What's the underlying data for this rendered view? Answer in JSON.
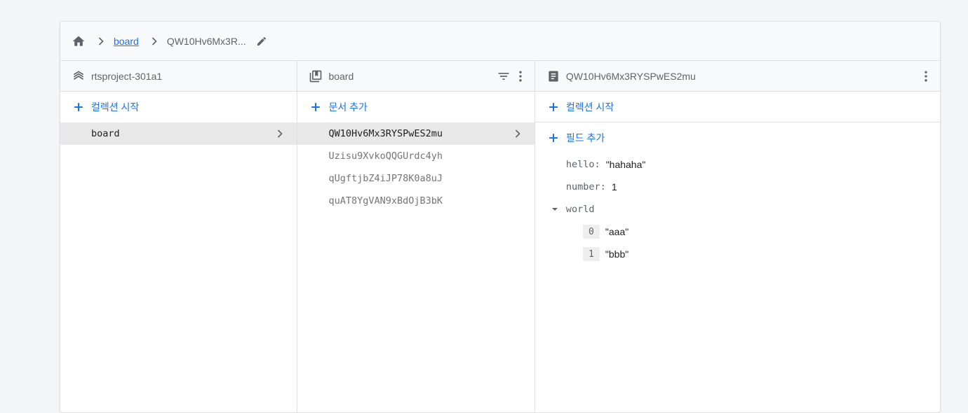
{
  "breadcrumb": {
    "collection": "board",
    "document": "QW10Hv6Mx3R..."
  },
  "columns": {
    "root": {
      "title": "rtsproject-301a1",
      "add_label": "컬렉션 시작",
      "items": [
        "board"
      ]
    },
    "collection": {
      "title": "board",
      "add_label": "문서 추가",
      "items": [
        "QW10Hv6Mx3RYSPwES2mu",
        "Uzisu9XvkoQQGUrdc4yh",
        "qUgftjbZ4iJP78K0a8uJ",
        "quAT8YgVAN9xBdOjB3bK"
      ]
    },
    "document": {
      "title": "QW10Hv6Mx3RYSPwES2mu",
      "add_collection_label": "컬렉션 시작",
      "add_field_label": "필드 추가",
      "fields": {
        "hello_key": "hello:",
        "hello_val": "\"hahaha\"",
        "number_key": "number:",
        "number_val": "1",
        "world_key": "world",
        "world_items": [
          {
            "index": "0",
            "value": "\"aaa\""
          },
          {
            "index": "1",
            "value": "\"bbb\""
          }
        ]
      }
    }
  },
  "colors": {
    "accent": "#1a73e8",
    "selected": "#e8e8e8"
  }
}
